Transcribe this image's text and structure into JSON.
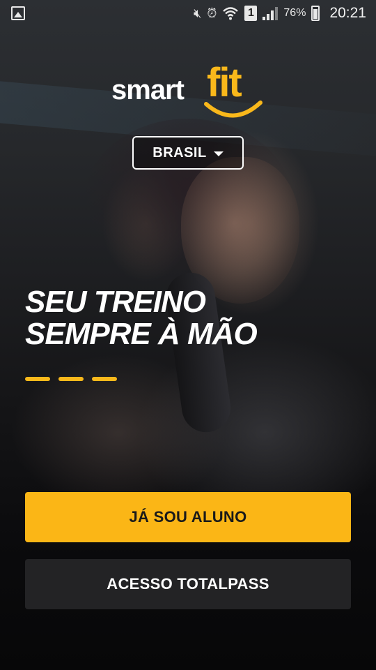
{
  "status_bar": {
    "battery": "76%",
    "time": "20:21",
    "sim_slot": "1",
    "icons": [
      "gallery-icon",
      "mute-icon",
      "alarm-icon",
      "wifi-icon",
      "sim-icon",
      "signal-icon",
      "battery-icon"
    ]
  },
  "logo": {
    "smart": "smart",
    "fit": "fit",
    "accent_color": "#f9b81b"
  },
  "country_selector": {
    "label": "BRASIL"
  },
  "hero": {
    "line1": "SEU TREINO",
    "line2": "SEMPRE À MÃO"
  },
  "buttons": {
    "primary": "JÁ SOU ALUNO",
    "secondary": "ACESSO TOTALPASS"
  },
  "colors": {
    "primary_button": "#fbb616",
    "secondary_button": "#232325"
  }
}
